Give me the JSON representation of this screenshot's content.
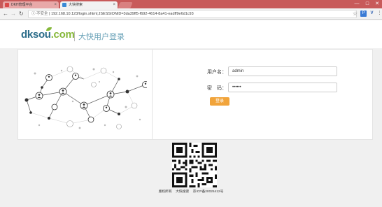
{
  "browser": {
    "tabs": [
      {
        "label": "DKH管理平台",
        "active": false
      },
      {
        "label": "大快搜索",
        "active": true
      }
    ],
    "url_security": "不安全",
    "url": "192.168.10.123/login.shtml;JSESSIONID=3da39ff5-f692-4614-8a41-eadff9e6d1c93",
    "window_controls": [
      "—",
      "□",
      "✕"
    ],
    "icons": [
      "back-arrow-icon",
      "forward-arrow-icon",
      "reload-icon",
      "info-icon",
      "star-icon",
      "extension-p-icon",
      "extension-v-icon",
      "menu-icon"
    ]
  },
  "header": {
    "logo_main": "dksou",
    "logo_suffix": ".com",
    "subtitle": "大快用户登录"
  },
  "login": {
    "username_label": "用户名：",
    "username_value": "admin",
    "password_label": "密　码：",
    "password_value": "••••••",
    "submit_label": "登录"
  },
  "footer": {
    "rights": "版权所有",
    "company": "大快搜索",
    "icp": "京ICP备20025412号"
  },
  "colors": {
    "tabbar": "#c85a5a",
    "brand_blue": "#2c6d8a",
    "brand_green": "#86b83a",
    "button": "#f1a43b"
  }
}
